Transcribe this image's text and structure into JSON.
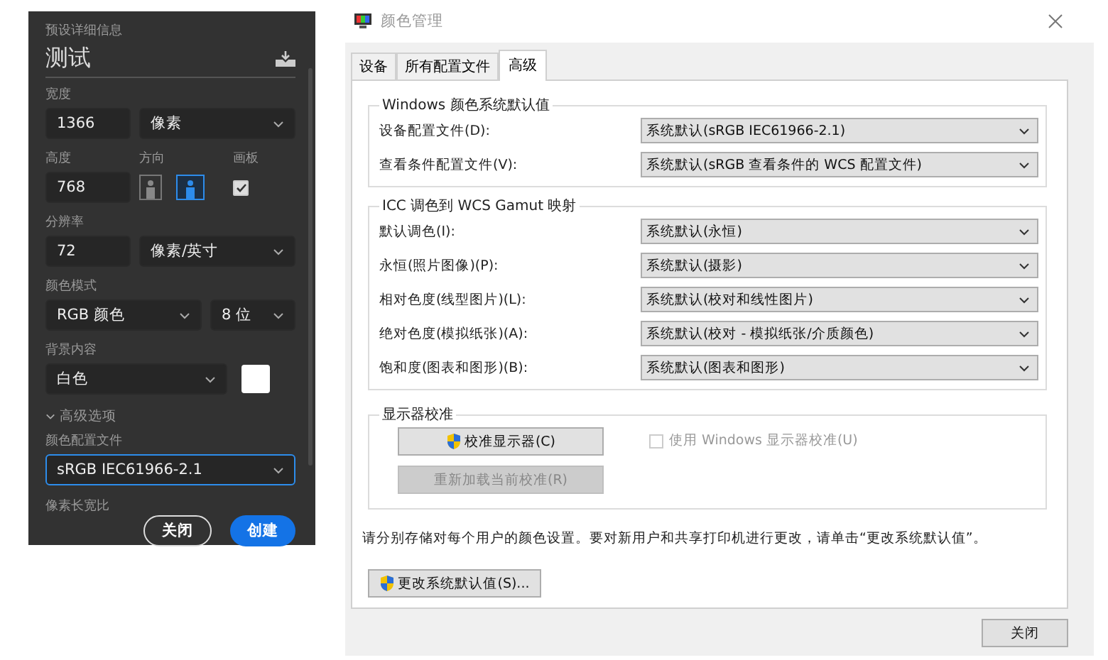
{
  "preset_panel": {
    "heading": "预设详细信息",
    "name": "测试",
    "width": {
      "label": "宽度",
      "value": "1366",
      "unit": "像素"
    },
    "height": {
      "label": "高度",
      "value": "768"
    },
    "orientation": {
      "label": "方向",
      "options": [
        {
          "kind": "portrait",
          "selected": false
        },
        {
          "kind": "landscape",
          "selected": true
        }
      ]
    },
    "artboard": {
      "label": "画板",
      "checked": true
    },
    "resolution": {
      "label": "分辨率",
      "value": "72",
      "unit": "像素/英寸"
    },
    "color_mode": {
      "label": "颜色模式",
      "mode": "RGB 颜色",
      "depth": "8 位"
    },
    "background": {
      "label": "背景内容",
      "value": "白色",
      "color": "#ffffff"
    },
    "advanced": {
      "label": "高级选项",
      "expanded": true
    },
    "color_profile": {
      "label": "颜色配置文件",
      "value": "sRGB IEC61966-2.1",
      "focused": true
    },
    "pixel_aspect": {
      "label": "像素长宽比"
    },
    "buttons": [
      {
        "label": "关闭",
        "kind": "secondary"
      },
      {
        "label": "创建",
        "kind": "primary"
      }
    ]
  },
  "dialog": {
    "title": "颜色管理",
    "tabs": [
      {
        "label": "设备",
        "selected": false
      },
      {
        "label": "所有配置文件",
        "selected": false
      },
      {
        "label": "高级",
        "selected": true
      }
    ],
    "groups": [
      {
        "title": "Windows 颜色系统默认值",
        "rows": [
          {
            "label": "设备配置文件(D):",
            "value": "系统默认(sRGB IEC61966-2.1)"
          },
          {
            "label": "查看条件配置文件(V):",
            "value": "系统默认(sRGB 查看条件的 WCS 配置文件)"
          }
        ]
      },
      {
        "title": "ICC 调色到 WCS Gamut 映射",
        "rows": [
          {
            "label": "默认调色(I):",
            "value": "系统默认(永恒)"
          },
          {
            "label": "永恒(照片图像)(P):",
            "value": "系统默认(摄影)"
          },
          {
            "label": "相对色度(线型图片)(L):",
            "value": "系统默认(校对和线性图片)"
          },
          {
            "label": "绝对色度(模拟纸张)(A):",
            "value": "系统默认(校对 - 模拟纸张/介质颜色)"
          },
          {
            "label": "饱和度(图表和图形)(B):",
            "value": "系统默认(图表和图形)"
          }
        ]
      }
    ],
    "calibration": {
      "title": "显示器校准",
      "calibrate_button": {
        "label": "校准显示器(C)",
        "disabled": false
      },
      "reload_button": {
        "label": "重新加载当前校准(R)",
        "disabled": true
      },
      "checkbox": {
        "label": "使用 Windows 显示器校准(U)",
        "checked": false,
        "disabled": true
      }
    },
    "note": "请分别存储对每个用户的颜色设置。要对新用户和共享打印机进行更改，请单击“更改系统默认值”。",
    "change_defaults_button": {
      "label": "更改系统默认值(S)..."
    },
    "close_button": {
      "label": "关闭"
    }
  }
}
